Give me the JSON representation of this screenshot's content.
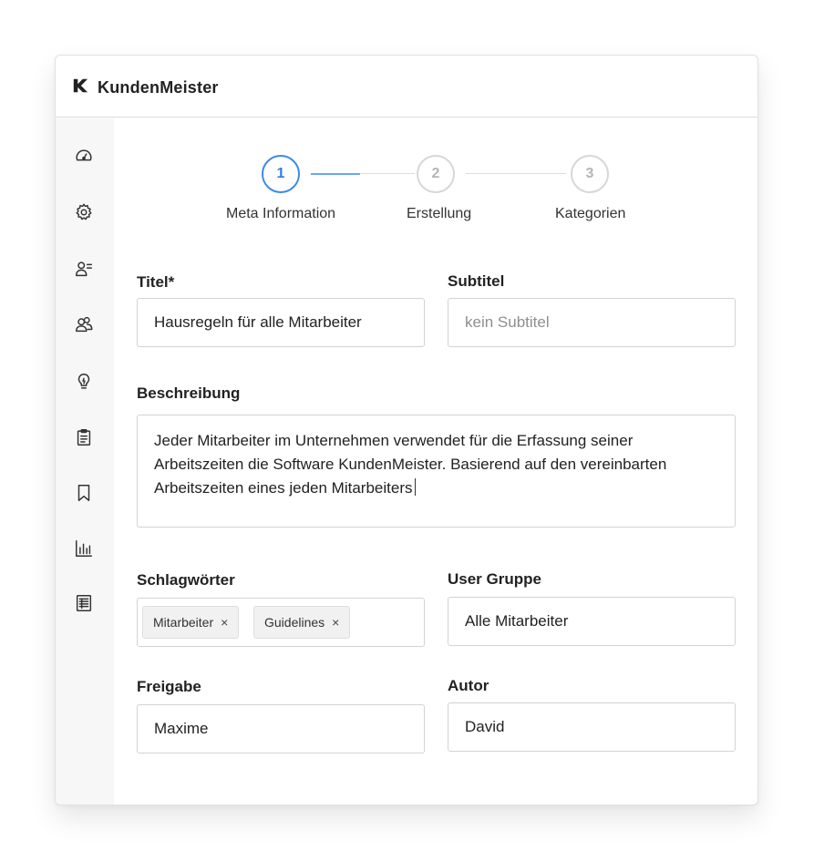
{
  "brand": {
    "name": "KundenMeister",
    "logo_icon": "k-logo-icon"
  },
  "sidebar": {
    "items": [
      {
        "name": "dashboard-gauge-icon"
      },
      {
        "name": "settings-gear-icon"
      },
      {
        "name": "user-list-icon"
      },
      {
        "name": "users-group-icon"
      },
      {
        "name": "lightbulb-icon"
      },
      {
        "name": "clipboard-icon"
      },
      {
        "name": "bookmark-icon"
      },
      {
        "name": "bar-chart-icon"
      },
      {
        "name": "document-list-icon"
      }
    ]
  },
  "stepper": {
    "steps": [
      {
        "number": "1",
        "label": "Meta Information",
        "state": "active"
      },
      {
        "number": "2",
        "label": "Erstellung",
        "state": "inactive"
      },
      {
        "number": "3",
        "label": "Kategorien",
        "state": "inactive"
      }
    ],
    "accent_color": "#3c8be6"
  },
  "form": {
    "title": {
      "label": "Titel*",
      "value": "Hausregeln für alle Mitarbeiter"
    },
    "subtitle": {
      "label": "Subtitel",
      "placeholder": "kein Subtitel",
      "value": ""
    },
    "description": {
      "label": "Beschreibung",
      "lines": [
        "Jeder Mitarbeiter im Unternehmen verwendet für die Erfassung seiner",
        "Arbeitszeiten die Software KundenMeister. Basierend auf den vereinbarten",
        "Arbeitszeiten eines jeden Mitarbeiters"
      ]
    },
    "keywords": {
      "label": "Schlagwörter",
      "tags": [
        {
          "text": "Mitarbeiter",
          "remove": "×"
        },
        {
          "text": "Guidelines",
          "remove": "×"
        }
      ]
    },
    "user_group": {
      "label": "User Gruppe",
      "value": "Alle Mitarbeiter"
    },
    "release": {
      "label": "Freigabe",
      "value": "Maxime"
    },
    "author": {
      "label": "Autor",
      "value": "David"
    }
  }
}
